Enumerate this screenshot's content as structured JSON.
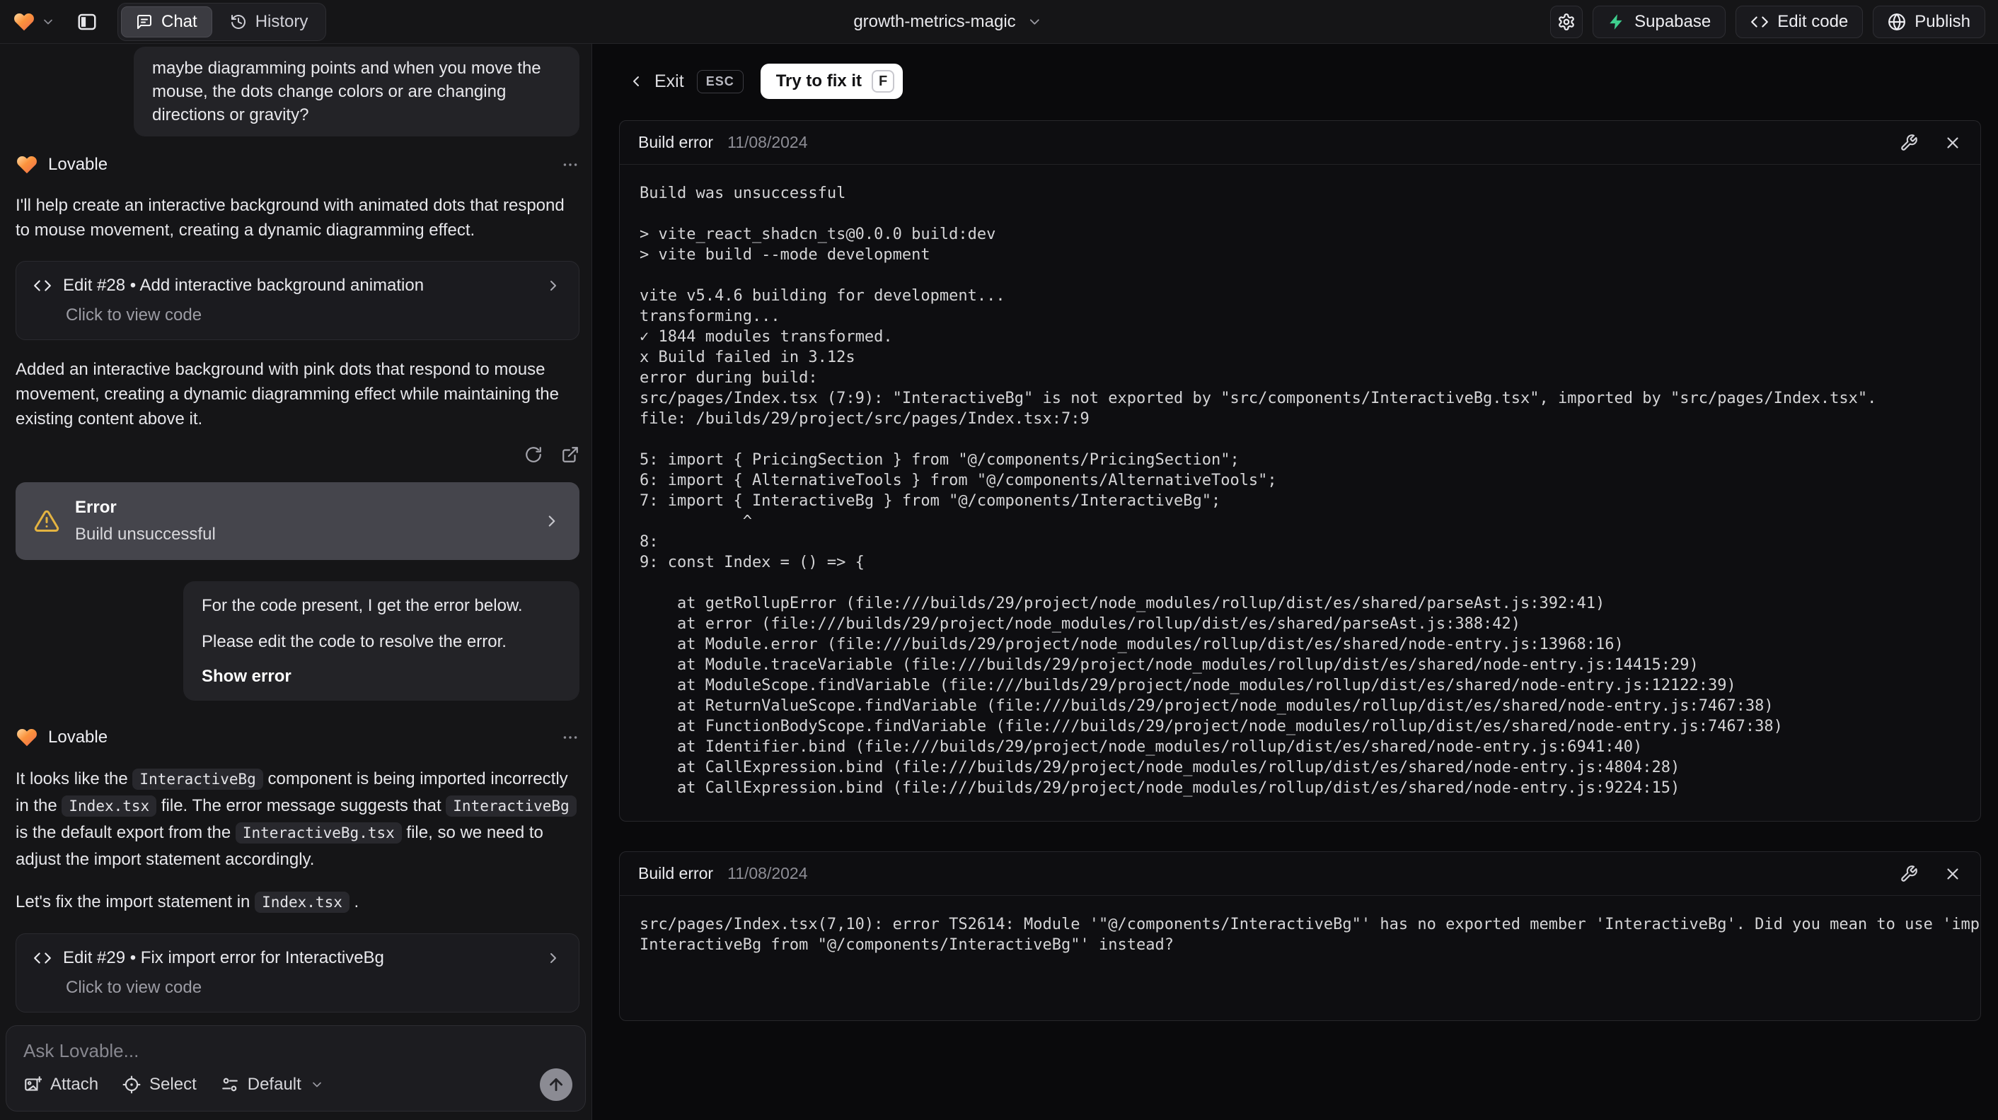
{
  "colors": {
    "supabase_green": "#3ecf8e",
    "warning_amber": "#e3b341",
    "fix_button_bg": "#ffffff",
    "error_card_bg": "#45454c"
  },
  "topbar": {
    "tabs": {
      "chat": "Chat",
      "history": "History"
    },
    "project_name": "growth-metrics-magic",
    "buttons": {
      "supabase": "Supabase",
      "edit_code": "Edit code",
      "publish": "Publish"
    }
  },
  "chat": {
    "assistant_name": "Lovable",
    "user_message_1": "maybe diagramming points and when you move the mouse, the dots change colors or are changing directions or gravity?",
    "msg1": {
      "intro": "I'll help create an interactive background with animated dots that respond to mouse movement, creating a dynamic diagramming effect.",
      "edit_card": {
        "title": "Edit #28 • Add interactive background animation",
        "subtitle": "Click to view code"
      },
      "summary": "Added an interactive background with pink dots that respond to mouse movement, creating a dynamic diagramming effect while maintaining the existing content above it.",
      "error_card": {
        "title": "Error",
        "subtitle": "Build unsuccessful"
      }
    },
    "user_message_2": {
      "line1": "For the code present, I get the error below.",
      "line2": "Please edit the code to resolve the error.",
      "action": "Show error"
    },
    "msg2": {
      "p1": [
        "It looks like the ",
        "InteractiveBg",
        " component is being imported incorrectly in the ",
        "Index.tsx",
        " file. The error message suggests that ",
        "InteractiveBg",
        " is the default export from the ",
        "InteractiveBg.tsx",
        " file, so we need to adjust the import statement accordingly."
      ],
      "p2": [
        "Let's fix the import statement in ",
        "Index.tsx",
        " ."
      ],
      "edit_card": {
        "title": "Edit #29 • Fix import error for InteractiveBg",
        "subtitle": "Click to view code"
      }
    },
    "input": {
      "placeholder": "Ask Lovable...",
      "attach": "Attach",
      "select": "Select",
      "mode": "Default"
    }
  },
  "error_view": {
    "exit_label": "Exit",
    "esc_key": "ESC",
    "fix_label": "Try to fix it",
    "fix_key": "F",
    "panel1": {
      "title": "Build error",
      "date": "11/08/2024",
      "log": "Build was unsuccessful\n\n> vite_react_shadcn_ts@0.0.0 build:dev\n> vite build --mode development\n\nvite v5.4.6 building for development...\ntransforming...\n✓ 1844 modules transformed.\nx Build failed in 3.12s\nerror during build:\nsrc/pages/Index.tsx (7:9): \"InteractiveBg\" is not exported by \"src/components/InteractiveBg.tsx\", imported by \"src/pages/Index.tsx\".\nfile: /builds/29/project/src/pages/Index.tsx:7:9\n\n5: import { PricingSection } from \"@/components/PricingSection\";\n6: import { AlternativeTools } from \"@/components/AlternativeTools\";\n7: import { InteractiveBg } from \"@/components/InteractiveBg\";\n           ^\n8: \n9: const Index = () => {\n\n    at getRollupError (file:///builds/29/project/node_modules/rollup/dist/es/shared/parseAst.js:392:41)\n    at error (file:///builds/29/project/node_modules/rollup/dist/es/shared/parseAst.js:388:42)\n    at Module.error (file:///builds/29/project/node_modules/rollup/dist/es/shared/node-entry.js:13968:16)\n    at Module.traceVariable (file:///builds/29/project/node_modules/rollup/dist/es/shared/node-entry.js:14415:29)\n    at ModuleScope.findVariable (file:///builds/29/project/node_modules/rollup/dist/es/shared/node-entry.js:12122:39)\n    at ReturnValueScope.findVariable (file:///builds/29/project/node_modules/rollup/dist/es/shared/node-entry.js:7467:38)\n    at FunctionBodyScope.findVariable (file:///builds/29/project/node_modules/rollup/dist/es/shared/node-entry.js:7467:38)\n    at Identifier.bind (file:///builds/29/project/node_modules/rollup/dist/es/shared/node-entry.js:6941:40)\n    at CallExpression.bind (file:///builds/29/project/node_modules/rollup/dist/es/shared/node-entry.js:4804:28)\n    at CallExpression.bind (file:///builds/29/project/node_modules/rollup/dist/es/shared/node-entry.js:9224:15)"
    },
    "panel2": {
      "title": "Build error",
      "date": "11/08/2024",
      "log": "src/pages/Index.tsx(7,10): error TS2614: Module '\"@/components/InteractiveBg\"' has no exported member 'InteractiveBg'. Did you mean to use 'import\nInteractiveBg from \"@/components/InteractiveBg\"' instead?"
    }
  }
}
